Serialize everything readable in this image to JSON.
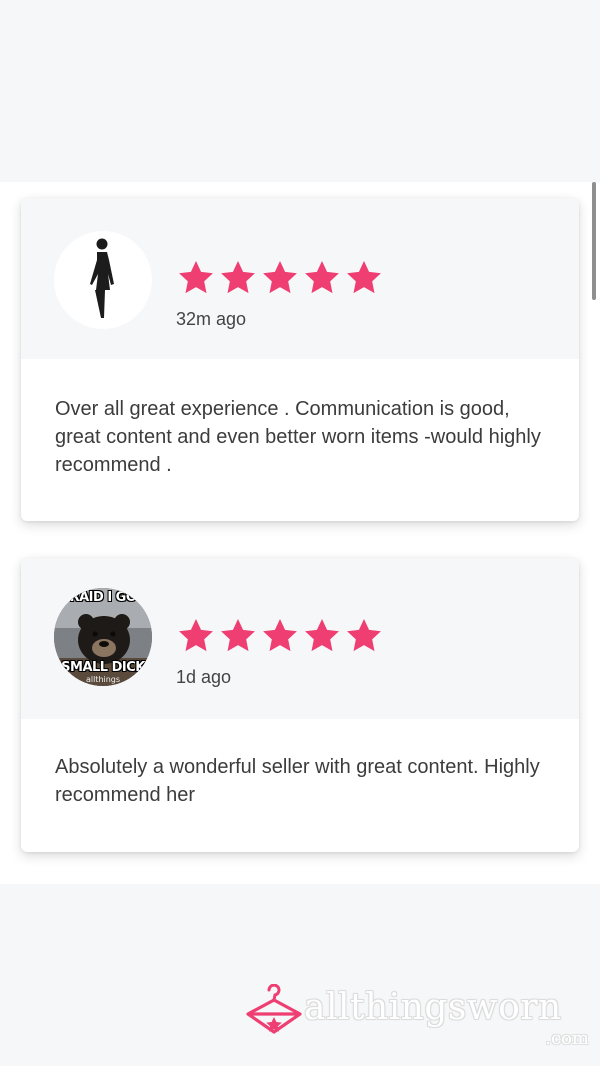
{
  "reviews": [
    {
      "avatar_icon": "female-figure-icon",
      "rating": 5,
      "time": "32m ago",
      "text": "Over all great experience . Communication is good, great content and even better worn items -would highly recommend ."
    },
    {
      "avatar_icon": "bear-photo-avatar",
      "avatar_caption_top": "RAID I GO",
      "avatar_caption_bottom": "SMALL DICK",
      "avatar_watermark": "allthings",
      "rating": 5,
      "time": "1d ago",
      "text": "Absolutely a wonderful seller with great content. Highly recommend her"
    }
  ],
  "brand": {
    "name": "allthingsworn",
    "suffix": ".com",
    "accent_color": "#ee3e72"
  }
}
